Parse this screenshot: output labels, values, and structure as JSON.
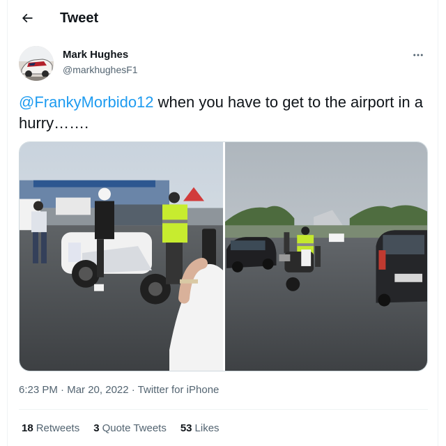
{
  "header": {
    "title": "Tweet",
    "back_icon": "arrow-left-icon"
  },
  "author": {
    "name": "Mark Hughes",
    "handle": "@markhughesF1",
    "avatar_icon": "profile-photo-car"
  },
  "tweet": {
    "mention": "@FrankyMorbido12",
    "text": " when you have to get to the airport in a hurry……."
  },
  "media": {
    "photos": [
      {
        "icon": "photo-police-motorcycle-rider"
      },
      {
        "icon": "photo-motorcycle-escort-road"
      }
    ]
  },
  "meta": {
    "time": "6:23 PM",
    "separator": " · ",
    "date": "Mar 20, 2022",
    "source": "Twitter for iPhone"
  },
  "stats": [
    {
      "count": "18",
      "label": "Retweets"
    },
    {
      "count": "3",
      "label": "Quote Tweets"
    },
    {
      "count": "53",
      "label": "Likes"
    }
  ],
  "colors": {
    "accent": "#1d9bf0",
    "text": "#0f1419",
    "secondary": "#536471",
    "border": "#eff3f4"
  }
}
